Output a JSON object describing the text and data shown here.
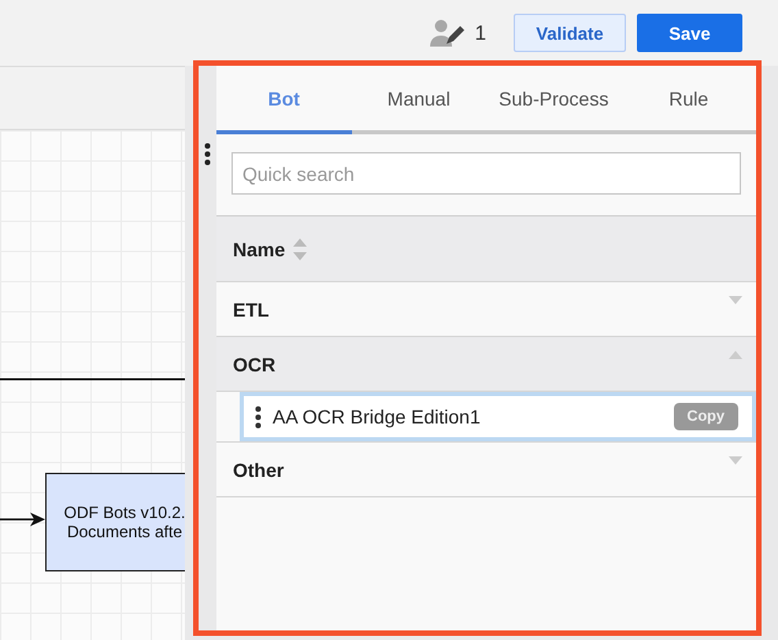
{
  "header": {
    "editors_count": "1",
    "buttons": [
      {
        "label": "Validate",
        "kind": "secondary"
      },
      {
        "label": "Save",
        "kind": "primary"
      }
    ]
  },
  "canvas": {
    "node": {
      "lines": [
        "ODF Bots v10.2.",
        "Documents afte"
      ]
    }
  },
  "panel": {
    "tabs": [
      {
        "label": "Bot",
        "selected": true
      },
      {
        "label": "Manual",
        "selected": false
      },
      {
        "label": "Sub-Process",
        "selected": false
      },
      {
        "label": "Rule",
        "selected": false
      }
    ],
    "search": {
      "placeholder": "Quick search"
    },
    "column_header": "Name",
    "groups": [
      {
        "name": "ETL",
        "expanded": false
      },
      {
        "name": "OCR",
        "expanded": true,
        "items": [
          {
            "name": "AA OCR Bridge Edition1",
            "action": "Copy"
          }
        ]
      },
      {
        "name": "Other",
        "expanded": false
      }
    ]
  }
}
